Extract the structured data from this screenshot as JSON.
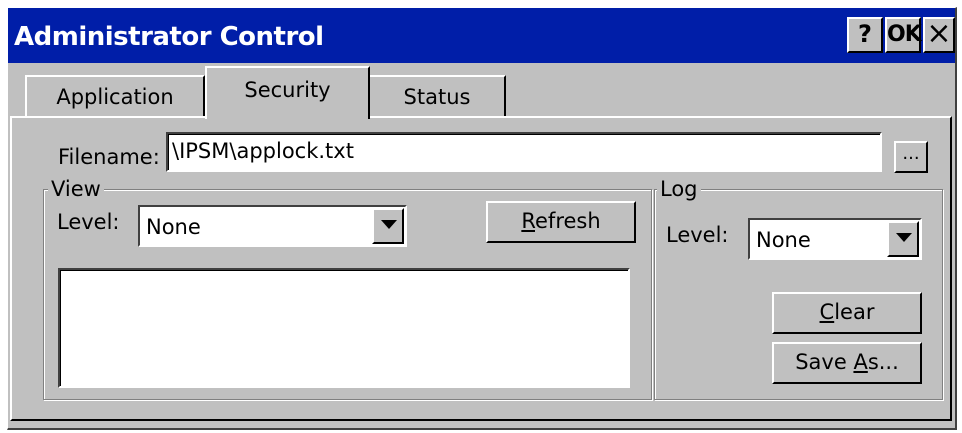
{
  "window": {
    "title": "Administrator Control",
    "help_label": "?",
    "ok_label": "OK",
    "close_label": "×"
  },
  "tabs": [
    {
      "label": "Application",
      "selected": false
    },
    {
      "label": "Security",
      "selected": true
    },
    {
      "label": "Status",
      "selected": false
    }
  ],
  "filename": {
    "label": "Filename:",
    "value": "\\IPSM\\applock.txt",
    "browse_label": "..."
  },
  "view": {
    "group_label": "View",
    "level_label": "Level:",
    "level_value": "None",
    "refresh_label_underlined": "R",
    "refresh_label_rest": "efresh"
  },
  "log": {
    "group_label": "Log",
    "level_label": "Level:",
    "level_value": "None",
    "clear_label_underlined": "C",
    "clear_label_rest": "lear",
    "save_as_prefix": "Save ",
    "save_as_underlined": "A",
    "save_as_rest": "s..."
  },
  "icons": {
    "dropdown": "chevron-down-icon",
    "close": "close-icon",
    "help": "help-icon"
  },
  "colors": {
    "titlebar": "#001ea8",
    "face": "#c0c0c0"
  }
}
